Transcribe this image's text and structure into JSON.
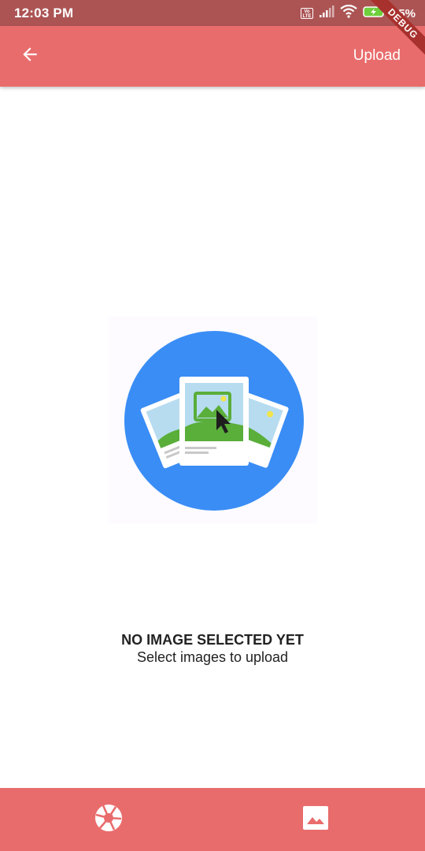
{
  "status_bar": {
    "time": "12:03 PM",
    "volte_label": "Vo LTE",
    "battery_percent": "95%",
    "icons": [
      "volte-icon",
      "signal-icon",
      "wifi-icon",
      "battery-charging-icon"
    ]
  },
  "debug_banner": "DEBUG",
  "app_bar": {
    "back_icon": "arrow-back-icon",
    "upload_label": "Upload"
  },
  "empty_state": {
    "illustration": "photo-gallery-illustration",
    "title": "NO IMAGE SELECTED YET",
    "subtitle": "Select images to upload"
  },
  "bottom_bar": {
    "camera_icon": "camera-shutter-icon",
    "gallery_icon": "image-gallery-icon"
  },
  "colors": {
    "status_bar": "#ac5454",
    "app_bar": "#e96c6c",
    "debug_ribbon": "#a8312d",
    "illustration_circle": "#3a8df5",
    "text": "#222222"
  }
}
